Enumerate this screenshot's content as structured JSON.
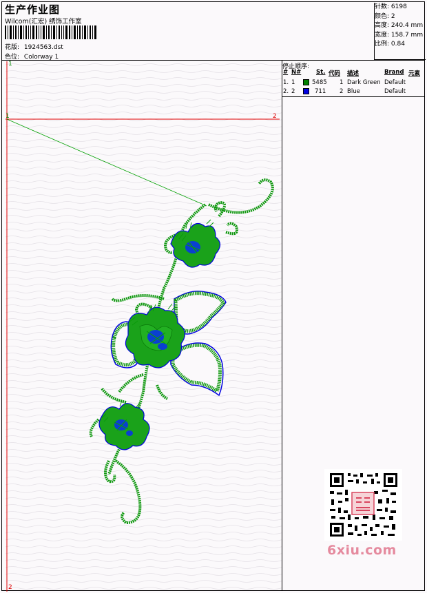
{
  "header": {
    "title": "生产作业图",
    "company": "Wilcom(汇宏) 绣饰工作室",
    "design_label": "花版:",
    "design_file": "1924563.dst",
    "colorway_label": "色位:",
    "colorway": "Colorway 1"
  },
  "stats": [
    {
      "label": "针数:",
      "value": "6198"
    },
    {
      "label": "颜色:",
      "value": "2"
    },
    {
      "label": "高度:",
      "value": "240.4 mm"
    },
    {
      "label": "宽度:",
      "value": "158.7 mm"
    },
    {
      "label": "比例:",
      "value": "0.84"
    }
  ],
  "stop_sequence": {
    "heading": "停止顺序:",
    "columns": [
      "#",
      "N#",
      "St.",
      "代码",
      "描述",
      "Brand",
      "元素"
    ],
    "rows": [
      {
        "idx": "1.",
        "n": "1",
        "color": "#008000",
        "stitches": "5485",
        "code": "1",
        "description": "Dark Green",
        "brand": "Default"
      },
      {
        "idx": "2.",
        "n": "2",
        "color": "#0000e0",
        "stitches": "711",
        "code": "2",
        "description": "Blue",
        "brand": "Default"
      }
    ]
  },
  "markers": {
    "top_left_1": "1",
    "hline_left_1": "1",
    "hline_right_2": "2",
    "bottom_left_2": "2"
  },
  "watermark": "6xiu.com",
  "colors": {
    "dark_green": "#008000",
    "blue": "#0000e0",
    "guide_red": "#e00000"
  }
}
